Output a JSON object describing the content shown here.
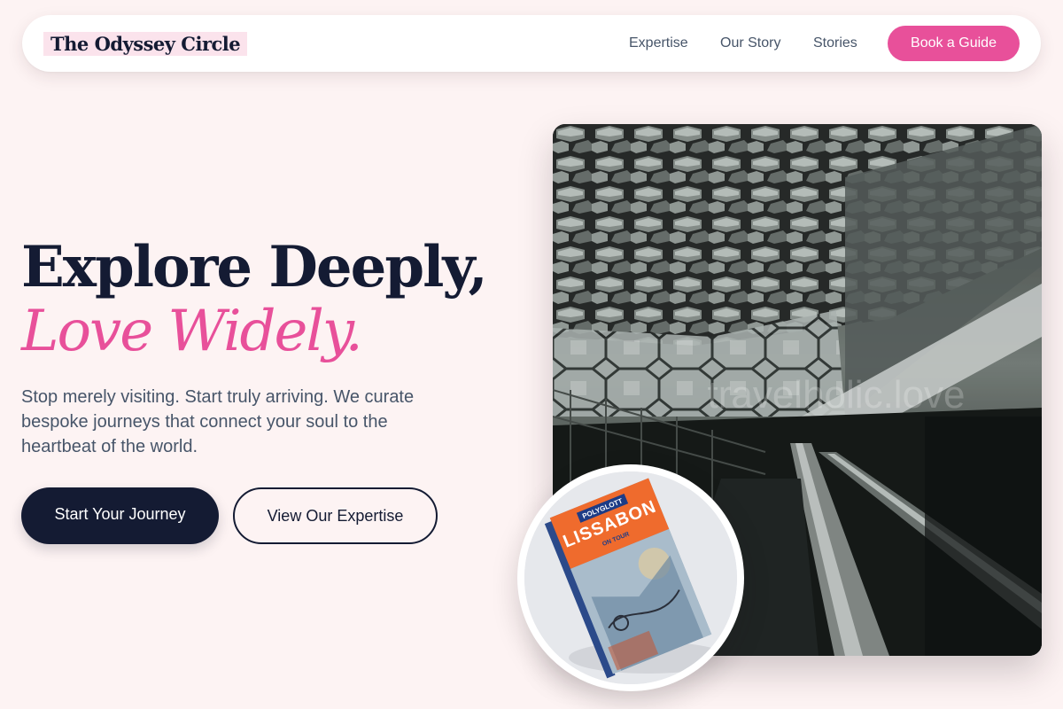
{
  "brand": {
    "name": "The Odyssey Circle"
  },
  "nav": {
    "links": [
      "Expertise",
      "Our Story",
      "Stories"
    ],
    "cta": "Book a Guide"
  },
  "hero": {
    "headline_line1": "Explore Deeply,",
    "headline_line2": "Love Widely.",
    "lede": "Stop merely visiting. Start truly arriving. We curate bespoke journeys that connect your soul to the heartbeat of the world.",
    "primary_cta": "Start Your Journey",
    "secondary_cta": "View Our Expertise"
  },
  "media": {
    "main_image_watermark": "travelholic.love",
    "book_cover": {
      "publisher": "POLYGLOTT",
      "title": "LISSABON",
      "subtitle": "ON TOUR"
    }
  },
  "colors": {
    "accent": "#e8509a",
    "navy": "#141b33",
    "background": "#fdf3f3",
    "text_muted": "#475569"
  }
}
